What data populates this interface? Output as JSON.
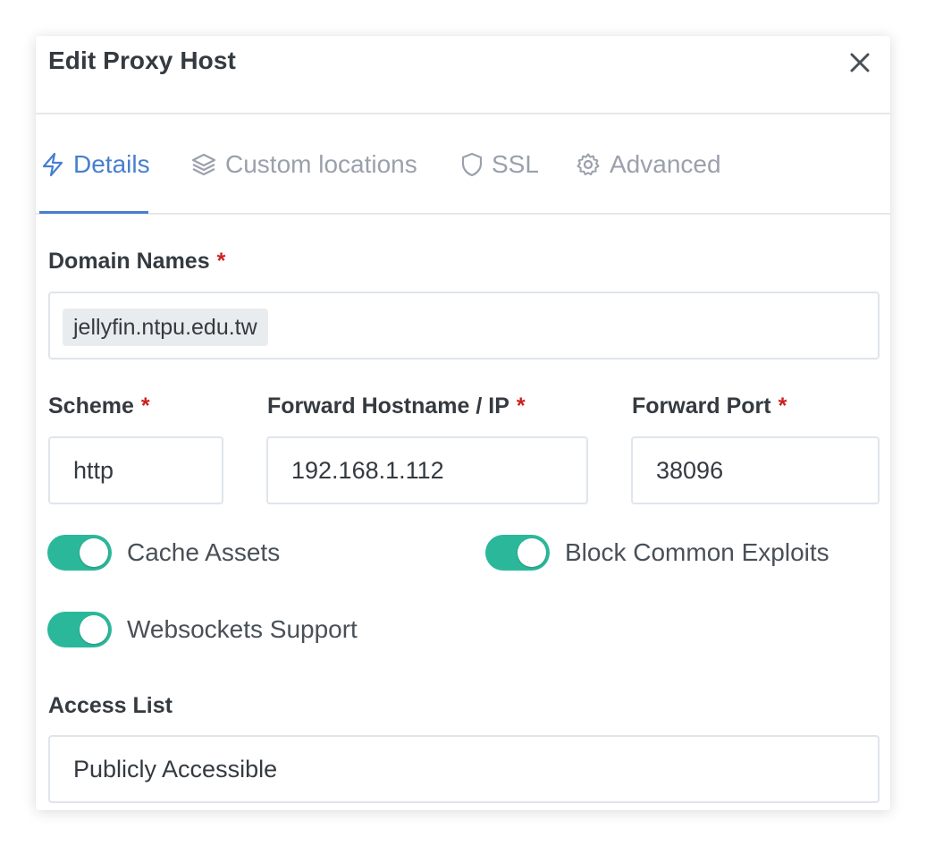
{
  "dialog": {
    "title": "Edit Proxy Host",
    "close_icon": "close-icon"
  },
  "tabs": [
    {
      "label": "Details",
      "icon": "bolt-icon",
      "active": true
    },
    {
      "label": "Custom locations",
      "icon": "layers-icon",
      "active": false
    },
    {
      "label": "SSL",
      "icon": "shield-icon",
      "active": false
    },
    {
      "label": "Advanced",
      "icon": "gear-icon",
      "active": false
    }
  ],
  "form": {
    "domain_names": {
      "label": "Domain Names",
      "required": "*",
      "tags": [
        "jellyfin.ntpu.edu.tw"
      ]
    },
    "scheme": {
      "label": "Scheme",
      "required": "*",
      "value": "http"
    },
    "forward_host": {
      "label": "Forward Hostname / IP",
      "required": "*",
      "value": "192.168.1.112"
    },
    "forward_port": {
      "label": "Forward Port",
      "required": "*",
      "value": "38096"
    },
    "toggles": [
      {
        "label": "Cache Assets",
        "checked": true
      },
      {
        "label": "Block Common Exploits",
        "checked": true
      },
      {
        "label": "Websockets Support",
        "checked": true
      }
    ],
    "access_list": {
      "label": "Access List",
      "value": "Publicly Accessible"
    }
  },
  "colors": {
    "accent": "#467fcf",
    "toggle_on": "#2bb89a",
    "required": "#cd201f",
    "muted_tab": "#9aa0ac"
  }
}
